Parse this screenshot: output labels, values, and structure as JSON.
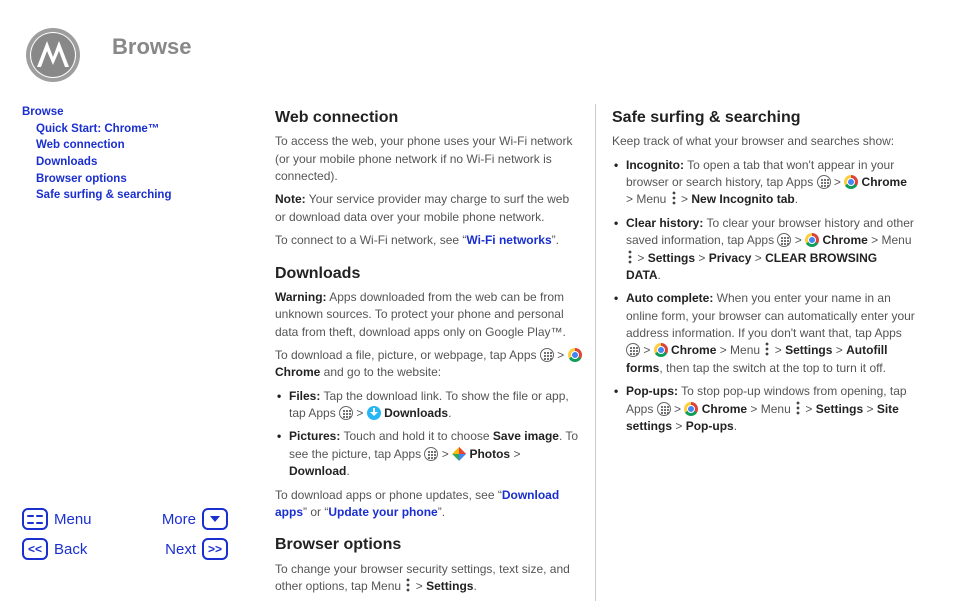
{
  "header": {
    "title": "Browse"
  },
  "toc": {
    "root": "Browse",
    "items": [
      "Quick Start: Chrome™",
      "Web connection",
      "Downloads",
      "Browser options",
      "Safe surfing & searching"
    ]
  },
  "left": {
    "web": {
      "heading": "Web connection",
      "p1": "To access the web, your phone uses your Wi-Fi network (or your mobile phone network if no Wi-Fi network is connected).",
      "note_label": "Note:",
      "note_text": " Your service provider may charge to surf the web or download data over your mobile phone network.",
      "p3a": "To connect to a Wi-Fi network, see “",
      "p3link": "Wi-Fi networks",
      "p3b": "”."
    },
    "dl": {
      "heading": "Downloads",
      "warn_label": "Warning:",
      "warn_text": " Apps downloaded from the web can be from unknown sources. To protect your phone and personal data from theft, download apps only on Google Play™.",
      "intro_a": "To download a file, picture, or webpage, tap Apps ",
      "intro_b": " > ",
      "intro_c": " Chrome",
      "intro_d": " and go to the website:",
      "files_label": "Files:",
      "files_a": " Tap the download link. To show the file or app, tap Apps ",
      "files_b": " > ",
      "files_c": " Downloads",
      "files_d": ".",
      "pics_label": "Pictures:",
      "pics_a": " Touch and hold it to choose ",
      "pics_save": "Save image",
      "pics_b": ". To see the picture, tap Apps ",
      "pics_c": " > ",
      "pics_photos": " Photos",
      "pics_d": " > ",
      "pics_download": "Download",
      "pics_e": ".",
      "out_a": "To download apps or phone updates, see “",
      "out_link1": "Download apps",
      "out_b": "” or “",
      "out_link2": "Update your phone",
      "out_c": "”."
    },
    "bo": {
      "heading": "Browser options",
      "p_a": "To change your browser security settings, text size, and other options, tap Menu ",
      "p_b": " > ",
      "p_settings": "Settings",
      "p_c": "."
    }
  },
  "right": {
    "heading": "Safe surfing & searching",
    "intro": "Keep track of what your browser and searches show:",
    "inc": {
      "label": "Incognito:",
      "a": " To open a tab that won't appear in your browser or search history, tap Apps ",
      "b": " > ",
      "chrome": " Chrome",
      "c": " > Menu ",
      "d": " > ",
      "newtab": "New Incognito tab",
      "e": "."
    },
    "clear": {
      "label": "Clear history:",
      "a": " To clear your browser history and other saved information, tap Apps ",
      "b": " > ",
      "chrome": " Chrome",
      "c": " > Menu ",
      "d": " > ",
      "settings": "Settings",
      "e": " > ",
      "privacy": "Privacy",
      "f": " > ",
      "caps": "CLEAR BROWSING DATA",
      "g": "."
    },
    "auto": {
      "label": "Auto complete:",
      "a": " When you enter your name in an online form, your browser can automatically enter your address information. If you don't want that, tap Apps ",
      "b": " > ",
      "chrome": " Chrome",
      "c": " > Menu ",
      "d": " > ",
      "settings": "Settings",
      "e": " > ",
      "autofill": "Autofill forms",
      "f": ", then tap the switch at the top to turn it off."
    },
    "pop": {
      "label": "Pop-ups:",
      "a": " To stop pop-up windows from opening, tap Apps ",
      "b": " > ",
      "chrome": " Chrome",
      "c": " > Menu ",
      "d": " > ",
      "settings": "Settings",
      "e": " > ",
      "site": "Site settings",
      "f": " > ",
      "popups": "Pop-ups",
      "g": "."
    }
  },
  "footer": {
    "menu": "Menu",
    "more": "More",
    "back": "Back",
    "next": "Next"
  }
}
